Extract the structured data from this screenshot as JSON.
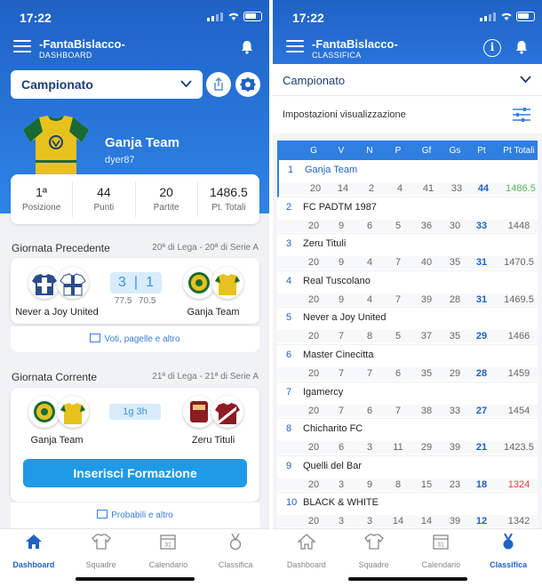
{
  "status": {
    "time_left": "17:22",
    "time_right": "17:22"
  },
  "left": {
    "app_title": "-FantaBislacco-",
    "app_subtitle": "DASHBOARD",
    "league_select": "Campionato",
    "team": {
      "name": "Ganja Team",
      "user": "dyer87"
    },
    "stats": [
      {
        "value": "1ª",
        "label": "Posizione"
      },
      {
        "value": "44",
        "label": "Punti"
      },
      {
        "value": "20",
        "label": "Partite"
      },
      {
        "value": "1486.5",
        "label": "Pt. Totali"
      }
    ],
    "previous": {
      "title": "Giornata Precedente",
      "info": "20ª di Lega - 20ª di Serie A",
      "home": "Never a Joy United",
      "away": "Ganja Team",
      "home_goals": "3",
      "away_goals": "1",
      "home_points": "77.5",
      "away_points": "70.5",
      "link": "Voti, pagelle e altro"
    },
    "current": {
      "title": "Giornata Corrente",
      "info": "21ª di Lega - 21ª di Serie A",
      "home": "Ganja Team",
      "away": "Zeru Tituli",
      "countdown": "1g 3h",
      "cta": "Inserisci Formazione",
      "link": "Probabili e altro"
    },
    "tabs": [
      {
        "label": "Dashboard",
        "icon": "home-icon",
        "active": true
      },
      {
        "label": "Squadre",
        "icon": "shirt-icon",
        "active": false
      },
      {
        "label": "Calendario",
        "icon": "calendar-icon",
        "active": false
      },
      {
        "label": "Classifica",
        "icon": "medal-icon",
        "active": false
      }
    ]
  },
  "right": {
    "app_title": "-FantaBislacco-",
    "app_subtitle": "CLASSIFICA",
    "league_select": "Campionato",
    "settings_label": "Impostazioni visualizzazione",
    "columns": [
      "G",
      "V",
      "N",
      "P",
      "Gf",
      "Gs",
      "Pt",
      "Pt Totali"
    ],
    "rows": [
      {
        "rank": "1",
        "name": "Ganja Team",
        "vals": [
          "20",
          "14",
          "2",
          "4",
          "41",
          "33",
          "44",
          "1486.5"
        ],
        "tot_color": "#5cb85c"
      },
      {
        "rank": "2",
        "name": "FC PADTM 1987",
        "vals": [
          "20",
          "9",
          "6",
          "5",
          "36",
          "30",
          "33",
          "1448"
        ],
        "tot_color": "#666666"
      },
      {
        "rank": "3",
        "name": "Zeru Tituli",
        "vals": [
          "20",
          "9",
          "4",
          "7",
          "40",
          "35",
          "31",
          "1470.5"
        ],
        "tot_color": "#666666"
      },
      {
        "rank": "4",
        "name": "Real Tuscolano",
        "vals": [
          "20",
          "9",
          "4",
          "7",
          "39",
          "28",
          "31",
          "1469.5"
        ],
        "tot_color": "#666666"
      },
      {
        "rank": "5",
        "name": "Never a Joy United",
        "vals": [
          "20",
          "7",
          "8",
          "5",
          "37",
          "35",
          "29",
          "1466"
        ],
        "tot_color": "#666666"
      },
      {
        "rank": "6",
        "name": "Master Cinecitta",
        "vals": [
          "20",
          "7",
          "7",
          "6",
          "35",
          "29",
          "28",
          "1459"
        ],
        "tot_color": "#666666"
      },
      {
        "rank": "7",
        "name": "Igamercy",
        "vals": [
          "20",
          "7",
          "6",
          "7",
          "38",
          "33",
          "27",
          "1454"
        ],
        "tot_color": "#666666"
      },
      {
        "rank": "8",
        "name": "Chicharito FC",
        "vals": [
          "20",
          "6",
          "3",
          "11",
          "29",
          "39",
          "21",
          "1423.5"
        ],
        "tot_color": "#666666"
      },
      {
        "rank": "9",
        "name": "Quelli del Bar",
        "vals": [
          "20",
          "3",
          "9",
          "8",
          "15",
          "23",
          "18",
          "1324"
        ],
        "tot_color": "#e0433b"
      },
      {
        "rank": "10",
        "name": "BLACK & WHITE",
        "vals": [
          "20",
          "3",
          "3",
          "14",
          "14",
          "39",
          "12",
          "1342"
        ],
        "tot_color": "#666666"
      }
    ],
    "tabs": [
      {
        "label": "Dashboard",
        "icon": "home-icon",
        "active": false
      },
      {
        "label": "Squadre",
        "icon": "shirt-icon",
        "active": false
      },
      {
        "label": "Calendario",
        "icon": "calendar-icon",
        "active": false
      },
      {
        "label": "Classifica",
        "icon": "medal-icon",
        "active": true
      }
    ]
  }
}
